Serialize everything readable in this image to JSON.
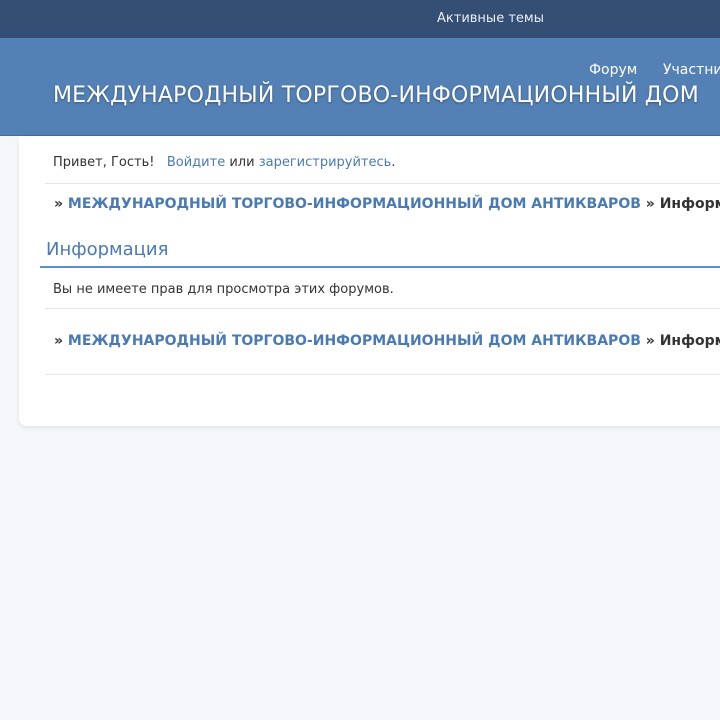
{
  "topbar": {
    "active_topics": "Активные темы"
  },
  "header": {
    "nav": {
      "forum": "Форум",
      "members": "Участни"
    },
    "title": "МЕЖДУНАРОДНЫЙ ТОРГОВО-ИНФОРМАЦИОННЫЙ ДОМ"
  },
  "welcome": {
    "greeting": "Привет, Гость!",
    "login": "Войдите",
    "or": "или",
    "register": "зарегистрируйтесь",
    "period": "."
  },
  "breadcrumb": {
    "separator": "»",
    "root": "МЕЖДУНАРОДНЫЙ ТОРГОВО-ИНФОРМАЦИОННЫЙ ДОМ АНТИКВАРОВ",
    "current": "Информ"
  },
  "info": {
    "title": "Информация",
    "message": "Вы не имеете прав для просмотра этих форумов."
  }
}
